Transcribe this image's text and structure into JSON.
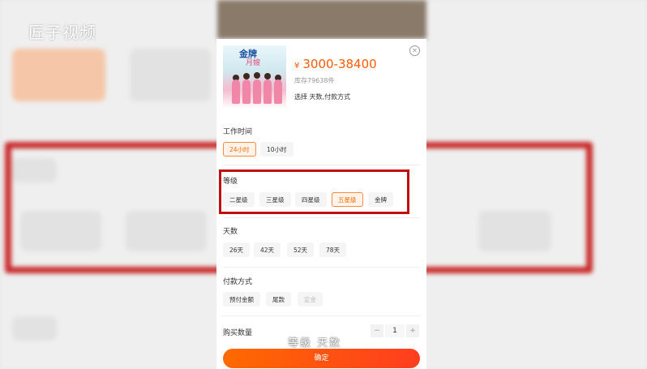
{
  "watermark": "匠子视频",
  "product": {
    "image_title": "金牌",
    "image_subtitle": "月嫂",
    "price_symbol": "¥",
    "price_range": "3000-38400",
    "stock": "库存79638件",
    "select_hint": "选择 天数,付款方式"
  },
  "sections": {
    "work_time": {
      "title": "工作时间",
      "options": [
        "24小时",
        "10小时"
      ],
      "selected": "24小时"
    },
    "level": {
      "title": "等级",
      "options": [
        "二星级",
        "三星级",
        "四星级",
        "五星级",
        "金牌"
      ],
      "selected": "五星级"
    },
    "days": {
      "title": "天数",
      "options": [
        "26天",
        "42天",
        "52天",
        "78天"
      ]
    },
    "payment": {
      "title": "付款方式",
      "options": [
        "预付金额",
        "尾款",
        "定金"
      ],
      "disabled": "定金"
    }
  },
  "quantity": {
    "label": "购买数量",
    "minus": "−",
    "value": "1",
    "plus": "+"
  },
  "confirm_label": "确定",
  "subtitle_caption": "等级 天数",
  "colors": {
    "accent": "#ff6a00",
    "highlight_frame": "#c10f0f"
  }
}
